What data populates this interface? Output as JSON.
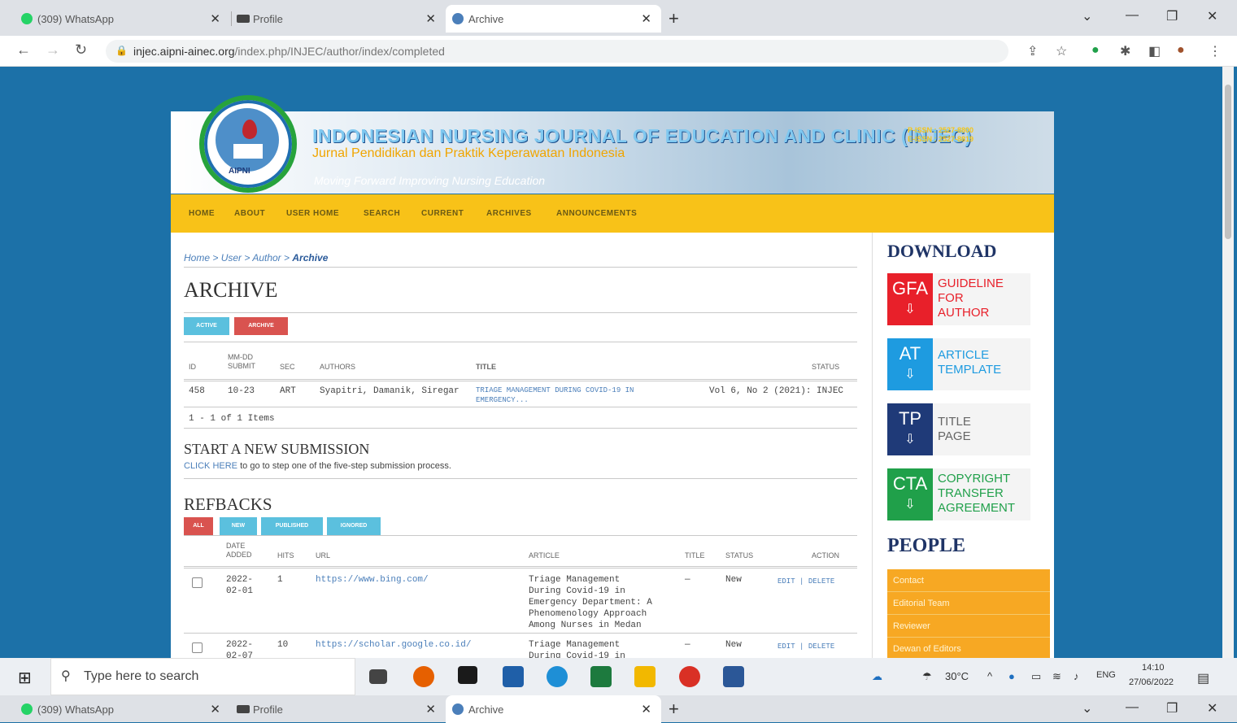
{
  "browser": {
    "tabs": [
      {
        "title": "(309) WhatsApp",
        "favicon_color": "#25d366"
      },
      {
        "title": "Profile",
        "favicon_color": "#444444"
      },
      {
        "title": "Archive",
        "favicon_color": "#4b7fba"
      }
    ],
    "url_host": "injec.aipni-ainec.org",
    "url_path": "/index.php/INJEC/author/index/completed"
  },
  "journal": {
    "logo_text": "AIPNI",
    "title": "INDONESIAN NURSING JOURNAL OF EDUCATION AND CLINIC (INJEC)",
    "issn": "P-ISSN : 2527-8800\nE-ISSN : 2527-8819",
    "subtitle": "Jurnal Pendidikan dan Praktik Keperawatan Indonesia",
    "slogan": "Moving Forward Improving Nursing Education"
  },
  "nav": [
    "HOME",
    "ABOUT",
    "USER HOME",
    "SEARCH",
    "CURRENT",
    "ARCHIVES",
    "ANNOUNCEMENTS"
  ],
  "breadcrumb": {
    "home": "Home",
    "sep": ">",
    "user": "User",
    "author": "Author",
    "current": "Archive"
  },
  "page_title": "ARCHIVE",
  "tabs": {
    "active": "ACTIVE",
    "archive": "ARCHIVE"
  },
  "archive_table": {
    "headers": {
      "id": "ID",
      "submit": "MM-DD\nSUBMIT",
      "sec": "SEC",
      "authors": "AUTHORS",
      "title": "TITLE",
      "status": "STATUS"
    },
    "rows": [
      {
        "id": "458",
        "submit": "10-23",
        "sec": "ART",
        "authors": "Syapitri, Damanik, Siregar",
        "title": "TRIAGE MANAGEMENT DURING COVID-19 IN EMERGENCY...",
        "status": "Vol 6, No 2 (2021): INJEC"
      }
    ],
    "count": "1 - 1 of 1 Items"
  },
  "new_submission": {
    "heading": "START A NEW SUBMISSION",
    "link": "CLICK HERE",
    "text": "to go to step one of the five-step submission process."
  },
  "refbacks": {
    "heading": "REFBACKS",
    "filters": [
      "ALL",
      "NEW",
      "PUBLISHED",
      "IGNORED"
    ],
    "headers": {
      "date": "DATE\nADDED",
      "hits": "HITS",
      "url": "URL",
      "article": "ARTICLE",
      "title": "TITLE",
      "status": "STATUS",
      "action": "ACTION"
    },
    "rows": [
      {
        "date": "2022-\n02-01",
        "hits": "1",
        "url": "https://www.bing.com/",
        "article": "Triage Management\nDuring Covid-19 in\nEmergency Department: A\nPhenomenology Approach\nAmong Nurses in Medan",
        "title": "—",
        "status": "New",
        "edit": "EDIT",
        "delete": "DELETE"
      },
      {
        "date": "2022-\n02-07",
        "hits": "10",
        "url": "https://scholar.google.co.id/",
        "article": "Triage Management\nDuring Covid-19 in",
        "title": "—",
        "status": "New",
        "edit": "EDIT",
        "delete": "DELETE"
      }
    ]
  },
  "sidebar": {
    "download_heading": "DOWNLOAD",
    "downloads": [
      {
        "abbr": "GFA",
        "label": "GUIDELINE\nFOR\nAUTHOR",
        "color": "#e8202a",
        "label_color": "#e8202a"
      },
      {
        "abbr": "AT",
        "label": "ARTICLE\nTEMPLATE",
        "color": "#1e9be0",
        "label_color": "#1e9be0"
      },
      {
        "abbr": "TP",
        "label": "TITLE\nPAGE",
        "color": "#1f3a78",
        "label_color": "#666666"
      },
      {
        "abbr": "CTA",
        "label": "COPYRIGHT\nTRANSFER\nAGREEMENT",
        "color": "#20a04a",
        "label_color": "#20a04a"
      }
    ],
    "people_heading": "PEOPLE",
    "people": [
      "Contact",
      "Editorial Team",
      "Reviewer",
      "Dewan of Editors"
    ]
  },
  "taskbar": {
    "search_placeholder": "Type here to search",
    "weather": "30°C",
    "lang": "ENG",
    "time": "14:10",
    "date": "27/06/2022"
  }
}
